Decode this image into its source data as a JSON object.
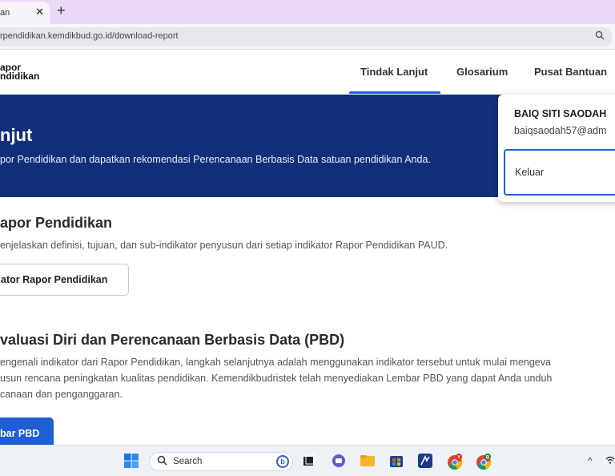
{
  "browser": {
    "tab_title": "an",
    "tab_close": "✕",
    "new_tab": "+",
    "url": "rpendidikan.kemdikbud.go.id/download-report",
    "search_icon": "search-icon"
  },
  "header": {
    "logo_line1": "apor",
    "logo_line2": "ndidikan",
    "nav": [
      {
        "label": "Tindak Lanjut",
        "active": true
      },
      {
        "label": "Glosarium",
        "active": false
      },
      {
        "label": "Pusat Bantuan",
        "active": false
      }
    ]
  },
  "hero": {
    "title": "njut",
    "subtitle": "por Pendidikan dan dapatkan rekomendasi Perencanaan Berbasis Data satuan pendidikan Anda."
  },
  "user_menu": {
    "name": "BAIQ SITI SAODAH",
    "email": "baiqsaodah57@adm",
    "logout_label": "Keluar"
  },
  "section1": {
    "title": "apor Pendidikan",
    "text": "enjelaskan definisi, tujuan, dan sub-indikator penyusun dari setiap indikator Rapor Pendidikan PAUD.",
    "button": "ator Rapor Pendidikan"
  },
  "section2": {
    "title": "valuasi Diri dan Perencanaan Berbasis Data (PBD)",
    "line1": "engenali indikator dari Rapor Pendidikan, langkah selanjutnya adalah menggunakan indikator tersebut untuk mulai mengeva",
    "line2": "usun rencana peningkatan kualitas pendidikan. Kemendikbudristek telah menyediakan Lembar PBD yang dapat Anda unduh",
    "line3": "canaan dan penganggaran.",
    "button": "bar PBD"
  },
  "taskbar": {
    "search_label": "Search",
    "bing_glyph": "b",
    "chrome_badge_1": "Y",
    "chrome_badge_2": "B",
    "tray_chevron": "^"
  },
  "colors": {
    "accent": "#1f5fd6",
    "hero_bg": "#12307a",
    "tabbar_bg": "#e9d8f7"
  }
}
